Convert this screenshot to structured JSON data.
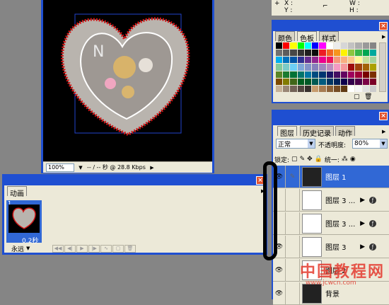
{
  "document": {
    "zoom": "100%",
    "status": "-- / -- 秒 @ 28.8 Kbps"
  },
  "animation": {
    "tab": "动画",
    "frame_number": "1",
    "delay": "0.2秒",
    "loop": "永远"
  },
  "info": {
    "x_label": "X :",
    "y_label": "Y :",
    "w_label": "W :",
    "h_label": "H :"
  },
  "swatches": {
    "tabs": [
      "颜色",
      "色板",
      "样式"
    ],
    "colors": [
      "#000000",
      "#ff0000",
      "#ffff00",
      "#00ff00",
      "#00ffff",
      "#0000ff",
      "#ff00ff",
      "#ffffff",
      "#ebebeb",
      "#d6d6d6",
      "#c2c2c2",
      "#adadad",
      "#999999",
      "#858585",
      "#707070",
      "#5c5c5c",
      "#474747",
      "#333333",
      "#1f1f1f",
      "#0a0a0a",
      "#ed1c24",
      "#f26522",
      "#f7941d",
      "#fff200",
      "#8dc63f",
      "#39b54a",
      "#00a651",
      "#00a99d",
      "#00aeef",
      "#0072bc",
      "#0054a6",
      "#2e3192",
      "#662d91",
      "#92278f",
      "#ec008c",
      "#ed145b",
      "#f69679",
      "#f9ad81",
      "#fdc68a",
      "#fff799",
      "#c4df9b",
      "#a3d39c",
      "#82ca9c",
      "#7accc8",
      "#6dcff6",
      "#7da7d9",
      "#8393ca",
      "#8781bd",
      "#a187be",
      "#bc8dbf",
      "#f49ac2",
      "#f6989d",
      "#9e0b0f",
      "#a0410d",
      "#a36209",
      "#aba000",
      "#598527",
      "#1a7b30",
      "#007236",
      "#00746b",
      "#0076a3",
      "#004b80",
      "#003471",
      "#1b1464",
      "#440e62",
      "#630460",
      "#9e005d",
      "#9e0039",
      "#790000",
      "#7b2e00",
      "#7d4900",
      "#827b00",
      "#406618",
      "#005e20",
      "#005826",
      "#005952",
      "#005b7f",
      "#003663",
      "#002157",
      "#0d004c",
      "#32004b",
      "#4b0049",
      "#7b0046",
      "#7a0026",
      "#c7b299",
      "#998675",
      "#736357",
      "#534741",
      "#37302d",
      "#c69c6d",
      "#a67c52",
      "#8c6239",
      "#754c24",
      "#603913",
      "#ffffff",
      "#f5f5f5",
      "#e0e0e0",
      "#cccccc"
    ]
  },
  "layers": {
    "tabs": [
      "图层",
      "历史记录",
      "动作"
    ],
    "blend_mode": "正常",
    "opacity_label": "不透明度:",
    "opacity_value": "80%",
    "lock_label": "锁定:",
    "unify_label": "统一:",
    "rows": [
      {
        "name": "图层 1",
        "visible": true,
        "selected": true,
        "fx": false
      },
      {
        "name": "图层 3 ...",
        "visible": false,
        "selected": false,
        "fx": true
      },
      {
        "name": "图层 3 ...",
        "visible": false,
        "selected": false,
        "fx": true
      },
      {
        "name": "图层 3",
        "visible": true,
        "selected": false,
        "fx": true
      },
      {
        "name": "图层 2",
        "visible": true,
        "selected": false,
        "fx": false
      },
      {
        "name": "背景",
        "visible": true,
        "selected": false,
        "fx": false
      }
    ]
  },
  "watermark": {
    "line1": "中国教程网",
    "line2": "www.jcwcn.com"
  }
}
